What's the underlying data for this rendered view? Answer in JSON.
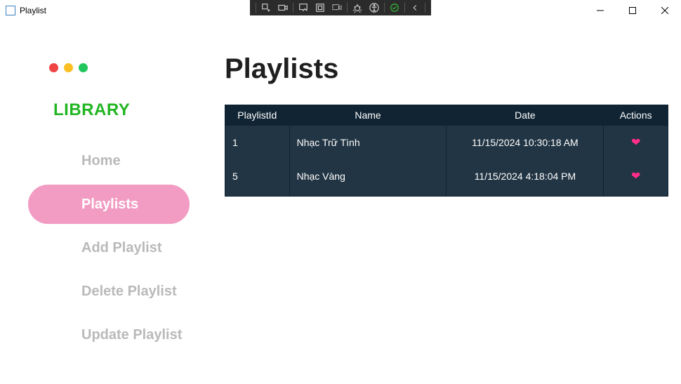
{
  "window": {
    "title": "Playlist"
  },
  "debugToolbar": {
    "buttons": [
      "select-element",
      "camera",
      "pointer-select",
      "box-model",
      "layout-inspect",
      "bug",
      "accessibility",
      "validate-ok",
      "collapse"
    ]
  },
  "sidebar": {
    "heading": "LIBRARY",
    "items": [
      {
        "label": "Home",
        "active": false
      },
      {
        "label": "Playlists",
        "active": true
      },
      {
        "label": "Add Playlist",
        "active": false
      },
      {
        "label": "Delete Playlist",
        "active": false
      },
      {
        "label": "Update Playlist",
        "active": false
      }
    ]
  },
  "page": {
    "title": "Playlists"
  },
  "table": {
    "columns": [
      "PlaylistId",
      "Name",
      "Date",
      "Actions"
    ],
    "rows": [
      {
        "id": "1",
        "name": "Nhạc Trữ Tình",
        "date": "11/15/2024 10:30:18 AM"
      },
      {
        "id": "5",
        "name": "Nhạc Vàng",
        "date": "11/15/2024 4:18:04 PM"
      }
    ],
    "actionIcon": "heart-icon"
  }
}
